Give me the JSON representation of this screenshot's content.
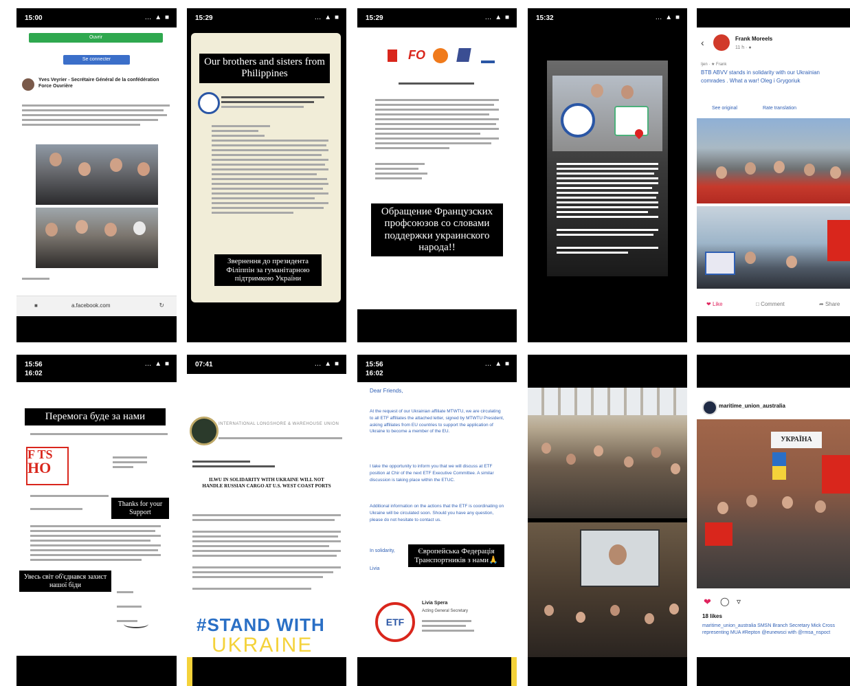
{
  "tiles": {
    "t1": {
      "time": "15:00",
      "status": "… ▲ ■",
      "author": "Yves Veyrier - Secrétaire Général de la confédération Force Ouvrière",
      "url": "a.facebook.com",
      "btn_green": "Ouvrir",
      "btn_blue": "Se connecter"
    },
    "t2": {
      "time": "15:29",
      "status": "… ▲ ■",
      "overlay_top": "Our brothers and sisters from Philippines",
      "overlay_bottom": "Звернення до президента Філіппін за гуманітарною підтримкою України"
    },
    "t3": {
      "time": "15:29",
      "status": "… ▲ ■",
      "logos": [
        "FO"
      ],
      "overlay": "Обращение Французских профсоюзов со словами поддержки украинского народа!!"
    },
    "t4": {
      "time": "15:32",
      "status": "… ▲ ■"
    },
    "t5": {
      "name": "Frank Moreels",
      "meta": "11 h · ●",
      "tag": "Ijen · ★ Frank",
      "post_text": "BTB ABVV stands in solidarity with our Ukrainian comrades . What a war! Oleg i Grygoriuk",
      "see_original": "See original",
      "rate": "Rate translation",
      "like": "Like",
      "comment": "Comment",
      "share": "Share"
    },
    "t6": {
      "time": "15:56",
      "time2": "16:02",
      "status": "… ▲ ■",
      "overlay_top": "Перемога буде за нами",
      "overlay_mid": "Thanks for your Support",
      "overlay_bottom": "Увесь світ об'єднався захист нашої біди",
      "logo_line1": "F TS",
      "logo_line2": "HO"
    },
    "t7": {
      "time": "07:41",
      "status": "… ▲ ■",
      "union_name": "INTERNATIONAL LONGSHORE & WAREHOUSE UNION",
      "headline": "ILWU IN SOLIDARITY WITH UKRAINE WILL NOT HANDLE RUSSIAN CARGO AT U.S. WEST COAST PORTS",
      "stand1": "#STAND WITH",
      "stand2": "UKRAINE"
    },
    "t8": {
      "time": "15:56",
      "time2": "16:02",
      "status": "… ▲ ■",
      "greeting": "Dear Friends,",
      "body": "At the request of our Ukrainian affiliate MTWTU, we are circulating to all ETF affiliates the attached letter, signed by MTWTU President, asking affiliates from EU countries to support the application of Ukraine to become a member of the EU.",
      "body2": "I take the opportunity to inform you that we will discuss at ETF position at Chir of the next ETF Executive Committee. A similar discussion is taking place within the ETUC.",
      "body3": "Additional information on the actions that the ETF is coordinating on Ukraine will be circulated soon. Should you have any question, please do not hesitate to contact us.",
      "solidarity": "In solidarity,",
      "love": "Livia",
      "overlay": "Європейська Федерація Транспортників з нами🙏",
      "signer": "Livia Spera",
      "signer_title": "Acting General Secretary",
      "logo": "ETF"
    },
    "t10": {
      "username": "maritime_union_australia",
      "sign_text": "УКРАЇНА",
      "likes": "18 likes",
      "caption": "maritime_union_australia SMSN Branch Secretary Mick Cross representing MUA #Repton @eunewsci with @rmsa_nspoct"
    }
  },
  "colors": {
    "tile_bg": "#000000",
    "fb_blue": "#2f5fb4",
    "paper": "#f1edd8",
    "btn_green": "#2fa84f",
    "like_red": "#e0245e",
    "stand_blue": "#2a6fc5",
    "stand_yellow": "#f4d23a"
  }
}
